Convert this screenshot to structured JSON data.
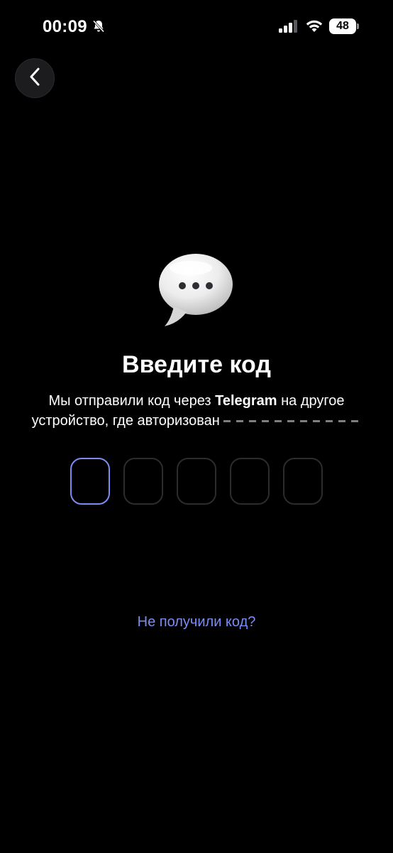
{
  "status_bar": {
    "time": "00:09",
    "battery": "48",
    "icons": [
      "bell-slash-icon",
      "signal-icon",
      "wifi-icon",
      "battery-icon"
    ]
  },
  "nav": {
    "back_icon": "chevron-left-icon"
  },
  "illustration": {
    "icon": "speech-bubble-ellipsis-icon"
  },
  "title": "Введите код",
  "subtitle": {
    "part1": "Мы отправили код через ",
    "app_name": "Telegram",
    "part2": " на другое устройство, где авторизован "
  },
  "code_input": {
    "length": 5,
    "active_index": 0,
    "active_color": "#7d8cf0",
    "inactive_color": "#2c2c2e"
  },
  "resend_link": "Не получили код?",
  "colors": {
    "background": "#000000",
    "accent": "#7b8df2"
  }
}
